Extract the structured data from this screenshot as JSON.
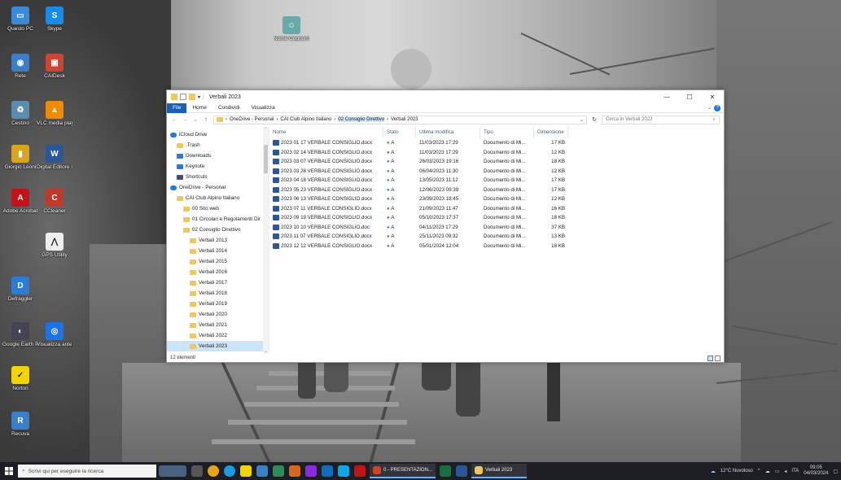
{
  "desktop_icons": [
    {
      "label": "Questo PC",
      "color": "#3b8ad9",
      "glyph": "▭"
    },
    {
      "label": "Skype",
      "color": "#1a8ae6",
      "glyph": "S"
    },
    {
      "label": "Rete",
      "color": "#3a7fc8",
      "glyph": "◉"
    },
    {
      "label": "CAIDesk",
      "color": "#c43",
      "glyph": "▣"
    },
    {
      "label": "Cestino",
      "color": "#5a8db0",
      "glyph": "♻"
    },
    {
      "label": "VLC media player",
      "color": "#f08a00",
      "glyph": "▲"
    },
    {
      "label": "Giorgio Leoni",
      "color": "#d9a520",
      "glyph": "▮"
    },
    {
      "label": "Digital Editore spese postali",
      "color": "#2b5797",
      "glyph": "W"
    },
    {
      "label": "Adobe Acrobat",
      "color": "#c0131a",
      "glyph": "A"
    },
    {
      "label": "CCleaner",
      "color": "#c0392b",
      "glyph": "C"
    },
    {
      "label": "GPS Utility",
      "color": "#eee",
      "glyph": "⋀"
    },
    {
      "label": "Defraggler",
      "color": "#2c7bd6",
      "glyph": "D"
    },
    {
      "label": "Google Earth Pro",
      "color": "#445",
      "glyph": "◐"
    },
    {
      "label": "Visualizza anteprima",
      "color": "#1a73e8",
      "glyph": "◎"
    },
    {
      "label": "Norton",
      "color": "#f2d400",
      "glyph": "✓"
    },
    {
      "label": "Recuva",
      "color": "#3a7fc8",
      "glyph": "R"
    },
    {
      "label": "Nome Cognome",
      "color": "#6aa",
      "glyph": "☺"
    }
  ],
  "window": {
    "title": "Verbali 2023",
    "ribbon_tabs": [
      "File",
      "Home",
      "Condividi",
      "Visualizza"
    ],
    "breadcrumb": [
      "OneDrive - Personal",
      "CAI Club Alpino Italiano",
      "02 Consiglio Direttivo",
      "Verbali 2023"
    ],
    "search_placeholder": "Cerca in Verbali 2023",
    "nav_items": [
      {
        "label": "iCloud Drive",
        "type": "cloud",
        "indent": 0
      },
      {
        "label": ".Trash",
        "type": "folder",
        "indent": 1
      },
      {
        "label": "Downloads",
        "type": "dl",
        "indent": 1
      },
      {
        "label": "Keynote",
        "type": "dl",
        "indent": 1
      },
      {
        "label": "Shortcuts",
        "type": "sc",
        "indent": 1
      },
      {
        "label": "OneDrive - Personal",
        "type": "cloud",
        "indent": 0
      },
      {
        "label": "CAI Club Alpino Italiano",
        "type": "folder",
        "indent": 1
      },
      {
        "label": "00 Sito web",
        "type": "folder",
        "indent": 2
      },
      {
        "label": "01 Circolari e Regolamenti Dir",
        "type": "folder",
        "indent": 2
      },
      {
        "label": "02 Consiglio Direttivo",
        "type": "folder",
        "indent": 2
      },
      {
        "label": "Verbali 2013",
        "type": "folder",
        "indent": 3
      },
      {
        "label": "Verbali 2014",
        "type": "folder",
        "indent": 3
      },
      {
        "label": "Verbali 2015",
        "type": "folder",
        "indent": 3
      },
      {
        "label": "Verbali 2016",
        "type": "folder",
        "indent": 3
      },
      {
        "label": "Verbali 2017",
        "type": "folder",
        "indent": 3
      },
      {
        "label": "Verbali 2018",
        "type": "folder",
        "indent": 3
      },
      {
        "label": "Verbali 2019",
        "type": "folder",
        "indent": 3
      },
      {
        "label": "Verbali 2020",
        "type": "folder",
        "indent": 3
      },
      {
        "label": "Verbali 2021",
        "type": "folder",
        "indent": 3
      },
      {
        "label": "Verbali 2022",
        "type": "folder",
        "indent": 3
      },
      {
        "label": "Verbali 2023",
        "type": "folder",
        "indent": 3,
        "selected": true
      }
    ],
    "columns": [
      "Nome",
      "Stato",
      "Ultima modifica",
      "Tipo",
      "Dimensione"
    ],
    "files": [
      [
        "2023 01 17 VERBALE CONSIGLIO.docx",
        "A",
        "11/03/2023 17:29",
        "Documento di Mi...",
        "17 KB"
      ],
      [
        "2023 02 14 VERBALE CONSIGLIO.docx",
        "A",
        "11/03/2023 17:29",
        "Documento di Mi...",
        "12 KB"
      ],
      [
        "2023 03 07 VERBALE CONSIGLIO.docx",
        "A",
        "26/03/2023 19:16",
        "Documento di Mi...",
        "18 KB"
      ],
      [
        "2023 03 28 VERBALE CONSIGLIO.docx",
        "A",
        "06/04/2023 11:30",
        "Documento di Mi...",
        "12 KB"
      ],
      [
        "2023 04 18 VERBALE CONSIGLIO.docx",
        "A",
        "13/05/2023 11:12",
        "Documento di Mi...",
        "17 KB"
      ],
      [
        "2023 05 23 VERBALE CONSIGLIO.docx",
        "A",
        "12/06/2023 09:39",
        "Documento di Mi...",
        "17 KB"
      ],
      [
        "2023 06 13 VERBALE CONSIGLIO.docx",
        "A",
        "23/09/2023 18:45",
        "Documento di Mi...",
        "12 KB"
      ],
      [
        "2023 07 11 VERBALE CONSIGLIO.docx",
        "A",
        "21/09/2023 11:47",
        "Documento di Mi...",
        "16 KB"
      ],
      [
        "2023 09 19 VERBALE CONSIGLIO.docx",
        "A",
        "05/10/2023 17:37",
        "Documento di Mi...",
        "18 KB"
      ],
      [
        "2023 10 10 VERBALE CONSIGLIO.doc",
        "A",
        "04/11/2023 17:29",
        "Documento di Mi...",
        "37 KB"
      ],
      [
        "2023 11 07 VERBALE CONSIGLIO.docx",
        "A",
        "25/11/2023 09:32",
        "Documento di Mi...",
        "13 KB"
      ],
      [
        "2023 12 12 VERBALE CONSIGLIO.docx",
        "A",
        "05/01/2024 12:04",
        "Documento di Mi...",
        "18 KB"
      ]
    ],
    "status_count": "12 elementi"
  },
  "taskbar": {
    "search_placeholder": "Scrivi qui per eseguire la ricerca",
    "apps": [
      {
        "label": "0 - PRESENTAZION..."
      },
      {
        "label": "Verbali 2023"
      }
    ],
    "weather": "12°C  Nuvoloso",
    "lang": "ITA",
    "time": "09:05",
    "date": "04/03/2024"
  },
  "colors": {
    "accent": "#1a5fb4",
    "taskbar": "#1d1d24",
    "selection": "#cce4f7"
  }
}
